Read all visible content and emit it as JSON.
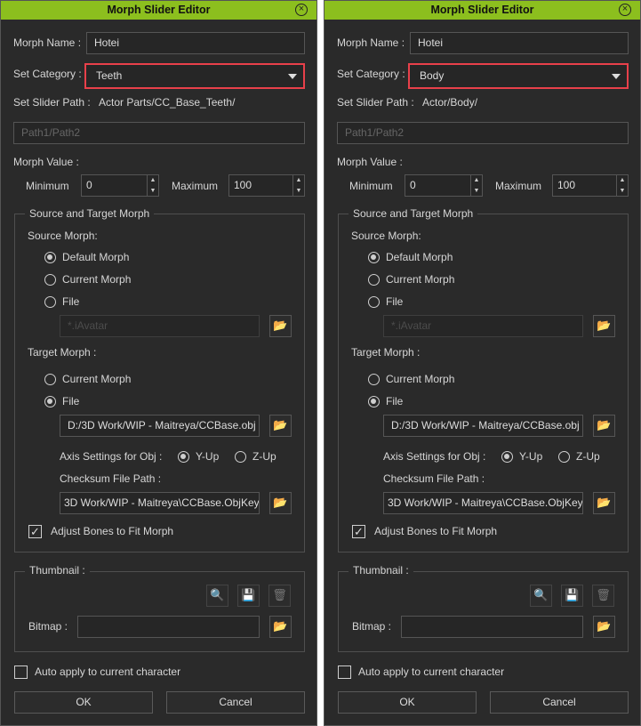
{
  "dialogs": [
    {
      "title": "Morph Slider Editor",
      "morph_name_label": "Morph Name :",
      "morph_name": "Hotei",
      "category_label": "Set Category :",
      "category": "Teeth",
      "slider_path_label": "Set Slider Path :",
      "slider_path": "Actor Parts/CC_Base_Teeth/",
      "path_placeholder": "Path1/Path2",
      "morph_value_label": "Morph Value :",
      "minimum_label": "Minimum",
      "minimum": "0",
      "maximum_label": "Maximum",
      "maximum": "100",
      "group_label": "Source and Target Morph",
      "source_label": "Source Morph:",
      "source_options": [
        "Default Morph",
        "Current Morph",
        "File"
      ],
      "source_selected": 0,
      "source_file_placeholder": "*.iAvatar",
      "target_label": "Target Morph :",
      "target_options": [
        "Current Morph",
        "File"
      ],
      "target_selected": 1,
      "target_file": "D:/3D Work/WIP - Maitreya/CCBase.obj",
      "axis_label": "Axis Settings for Obj :",
      "axis_options": [
        "Y-Up",
        "Z-Up"
      ],
      "axis_selected": 0,
      "checksum_label": "Checksum File Path :",
      "checksum_file": "3D Work/WIP - Maitreya\\CCBase.ObjKey",
      "adjust_bones_label": "Adjust Bones to Fit Morph",
      "adjust_bones_checked": true,
      "thumbnail_label": "Thumbnail :",
      "bitmap_label": "Bitmap :",
      "bitmap_value": "",
      "auto_apply_label": "Auto apply to current character",
      "auto_apply_checked": false,
      "ok_label": "OK",
      "cancel_label": "Cancel"
    },
    {
      "title": "Morph Slider Editor",
      "morph_name_label": "Morph Name :",
      "morph_name": "Hotei",
      "category_label": "Set Category :",
      "category": "Body",
      "slider_path_label": "Set Slider Path :",
      "slider_path": "Actor/Body/",
      "path_placeholder": "Path1/Path2",
      "morph_value_label": "Morph Value :",
      "minimum_label": "Minimum",
      "minimum": "0",
      "maximum_label": "Maximum",
      "maximum": "100",
      "group_label": "Source and Target Morph",
      "source_label": "Source Morph:",
      "source_options": [
        "Default Morph",
        "Current Morph",
        "File"
      ],
      "source_selected": 0,
      "source_file_placeholder": "*.iAvatar",
      "target_label": "Target Morph :",
      "target_options": [
        "Current Morph",
        "File"
      ],
      "target_selected": 1,
      "target_file": "D:/3D Work/WIP - Maitreya/CCBase.obj",
      "axis_label": "Axis Settings for Obj :",
      "axis_options": [
        "Y-Up",
        "Z-Up"
      ],
      "axis_selected": 0,
      "checksum_label": "Checksum File Path :",
      "checksum_file": "3D Work/WIP - Maitreya\\CCBase.ObjKey",
      "adjust_bones_label": "Adjust Bones to Fit Morph",
      "adjust_bones_checked": true,
      "thumbnail_label": "Thumbnail :",
      "bitmap_label": "Bitmap :",
      "bitmap_value": "",
      "auto_apply_label": "Auto apply to current character",
      "auto_apply_checked": false,
      "ok_label": "OK",
      "cancel_label": "Cancel"
    }
  ],
  "colors": {
    "title_bar": "#8cbf1e",
    "highlight": "#e8404a",
    "background": "#2a2a2a"
  },
  "icons": {
    "close": "close-circle-icon",
    "browse": "folder-import-icon",
    "thumb_capture": "folder-search-icon",
    "thumb_save": "save-icon",
    "thumb_delete": "trash-icon"
  }
}
